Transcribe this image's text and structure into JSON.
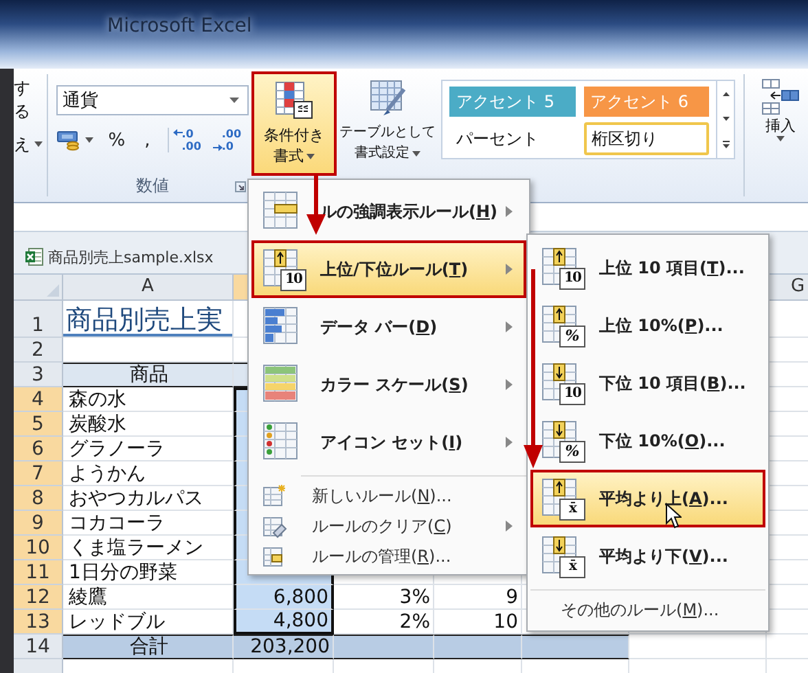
{
  "window": {
    "title": "Microsoft Excel"
  },
  "ribbon": {
    "clipped_labels": [
      {
        "label": "する",
        "dropdown": false
      },
      {
        "label": "え",
        "dropdown": true
      }
    ],
    "number_group": {
      "format": "通貨",
      "label": "数値",
      "buttons": [
        {
          "kind": "currency"
        },
        {
          "kind": "text",
          "label": "%"
        },
        {
          "kind": "text",
          "label": ","
        },
        {
          "kind": "increase_decimal",
          "lines": [
            ".0",
            ".00"
          ]
        },
        {
          "kind": "decrease_decimal",
          "lines": [
            ".00",
            ".0"
          ]
        }
      ]
    },
    "conditional_format": {
      "lines": [
        "条件付き",
        "書式"
      ],
      "highlighted": true
    },
    "table_format": {
      "lines": [
        "テーブルとして",
        "書式設定"
      ]
    },
    "cell_styles": [
      {
        "label": "アクセント 5",
        "kind": "accent",
        "color": "#4bacc6",
        "selected": false
      },
      {
        "label": "アクセント 6",
        "kind": "accent",
        "color": "#f79646",
        "selected": false
      },
      {
        "label": "パーセント",
        "kind": "plain",
        "selected": false
      },
      {
        "label": "桁区切り",
        "kind": "plain",
        "selected": true
      }
    ],
    "insert": {
      "label": "挿入"
    }
  },
  "workbook_tab": {
    "title": "商品別売上sample.xlsx"
  },
  "sheet": {
    "columns": [
      {
        "label": "A",
        "selected": false
      },
      {
        "selected": true
      },
      {
        "label": "G",
        "selected": false
      }
    ],
    "rows": [
      {
        "header": "1",
        "kind": "title",
        "selected": false,
        "cells": [
          "商品別売上実"
        ]
      },
      {
        "header": "2",
        "kind": "blank",
        "selected": false
      },
      {
        "header": "3",
        "kind": "heading",
        "selected": false,
        "cells": [
          "商品"
        ]
      },
      {
        "header": "4",
        "kind": "data",
        "selected": true,
        "cells": [
          "森の水"
        ]
      },
      {
        "header": "5",
        "kind": "data",
        "selected": true,
        "cells": [
          "炭酸水"
        ]
      },
      {
        "header": "6",
        "kind": "data",
        "selected": true,
        "cells": [
          "グラノーラ"
        ]
      },
      {
        "header": "7",
        "kind": "data",
        "selected": true,
        "cells": [
          "ようかん"
        ]
      },
      {
        "header": "8",
        "kind": "data",
        "selected": true,
        "cells": [
          "おやつカルパス"
        ]
      },
      {
        "header": "9",
        "kind": "data",
        "selected": true,
        "cells": [
          "コカコーラ"
        ]
      },
      {
        "header": "10",
        "kind": "data",
        "selected": true,
        "cells": [
          "くま塩ラーメン"
        ]
      },
      {
        "header": "11",
        "kind": "data",
        "selected": true,
        "cells": [
          "1日分の野菜"
        ]
      },
      {
        "header": "12",
        "kind": "data",
        "selected": true,
        "cells": [
          "綾鷹",
          "6,800",
          "3%",
          "9"
        ]
      },
      {
        "header": "13",
        "kind": "data",
        "selected": true,
        "cells": [
          "レッドブル",
          "4,800",
          "2%",
          "10"
        ]
      },
      {
        "header": "14",
        "kind": "total",
        "selected": false,
        "cells": [
          "合計",
          "203,200"
        ]
      }
    ]
  },
  "menu": {
    "items": [
      {
        "kind": "large",
        "before": "ルの強調表示ルール(",
        "key": "H",
        "after": ")",
        "submenu": true,
        "selected": false
      },
      {
        "kind": "large",
        "badge": "10",
        "before": "上位/下位ルール(",
        "key": "T",
        "after": ")",
        "submenu": true,
        "selected": true
      },
      {
        "kind": "large",
        "before": "データ バー(",
        "key": "D",
        "after": ")",
        "submenu": true,
        "selected": false
      },
      {
        "kind": "large",
        "before": "カラー スケール(",
        "key": "S",
        "after": ")",
        "submenu": true,
        "selected": false
      },
      {
        "kind": "large",
        "before": "アイコン セット(",
        "key": "I",
        "after": ")",
        "submenu": true,
        "selected": false
      },
      {
        "kind": "small",
        "before": "新しいルール(",
        "key": "N",
        "after": ")...",
        "submenu": false,
        "selected": false
      },
      {
        "kind": "small",
        "before": "ルールのクリア(",
        "key": "C",
        "after": ")",
        "submenu": true,
        "selected": false
      },
      {
        "kind": "small",
        "before": "ルールの管理(",
        "key": "R",
        "after": ")...",
        "submenu": false,
        "selected": false
      }
    ]
  },
  "submenu": {
    "items": [
      {
        "kind": "large",
        "badge": "10",
        "before": "上位 10 項目(",
        "key": "T",
        "after": ")...",
        "selected": false
      },
      {
        "kind": "large",
        "badge": "%",
        "before": "上位 10%(",
        "key": "P",
        "after": ")...",
        "selected": false
      },
      {
        "kind": "large",
        "badge": "10",
        "before": "下位 10 項目(",
        "key": "B",
        "after": ")...",
        "selected": false
      },
      {
        "kind": "large",
        "badge": "%",
        "before": "下位 10%(",
        "key": "O",
        "after": ")...",
        "selected": false
      },
      {
        "kind": "large",
        "badge": "x̄",
        "before": "平均より上(",
        "key": "A",
        "after": ")...",
        "selected": true
      },
      {
        "kind": "large",
        "badge": "x̄",
        "before": "平均より下(",
        "key": "V",
        "after": ")...",
        "selected": false
      },
      {
        "kind": "small",
        "before": "その他のルール(",
        "key": "M",
        "after": ")...",
        "selected": false
      }
    ]
  }
}
